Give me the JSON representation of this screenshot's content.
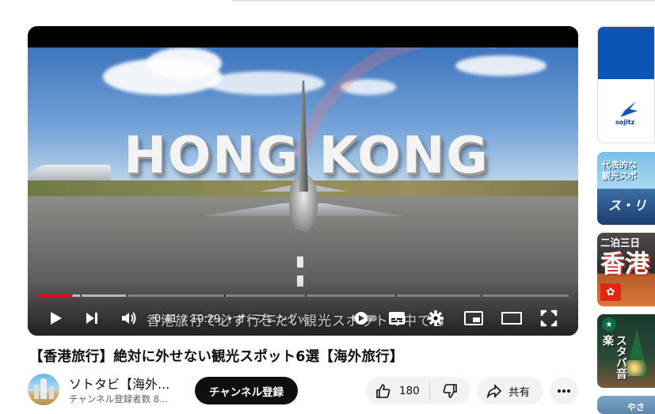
{
  "player": {
    "hero_text": "HONG KONG",
    "caption": "香港旅行で必ず行きたい観光スポットの中でも",
    "time_current": "0:41",
    "time_separator": "/",
    "time_total": "10:29",
    "chapter": "• オープニング ›",
    "progress_played_fraction": 0.065,
    "progress_buffered_fraction": 0.17,
    "controls": [
      "play-icon",
      "next-icon",
      "volume-icon",
      "autoplay-toggle",
      "subtitles-icon",
      "settings-icon",
      "miniplayer-icon",
      "theater-icon",
      "fullscreen-icon"
    ]
  },
  "video": {
    "title": "【香港旅行】絶対に外せない観光スポット6選【海外旅行】",
    "channel_name": "ソトタビ【海外...",
    "subscribers": "チャンネル登録者数 8...",
    "subscribe_label": "チャンネル登録",
    "like_count": "180",
    "share_label": "共有"
  },
  "sidebar": {
    "ad_logo_text": "sojitz",
    "items": [
      {
        "line1": "代表的な",
        "line2": "観光スポ",
        "line3": "ス・リ"
      },
      {
        "top": "二泊三日",
        "big": "香港"
      },
      {
        "text": "スタバ音楽"
      },
      {
        "text": "やさ"
      }
    ]
  },
  "colors": {
    "accent": "#ff0000",
    "subscribe_bg": "#0f0f0f",
    "pill_bg": "#f2f2f2",
    "ad_brand": "#0a55b5"
  }
}
